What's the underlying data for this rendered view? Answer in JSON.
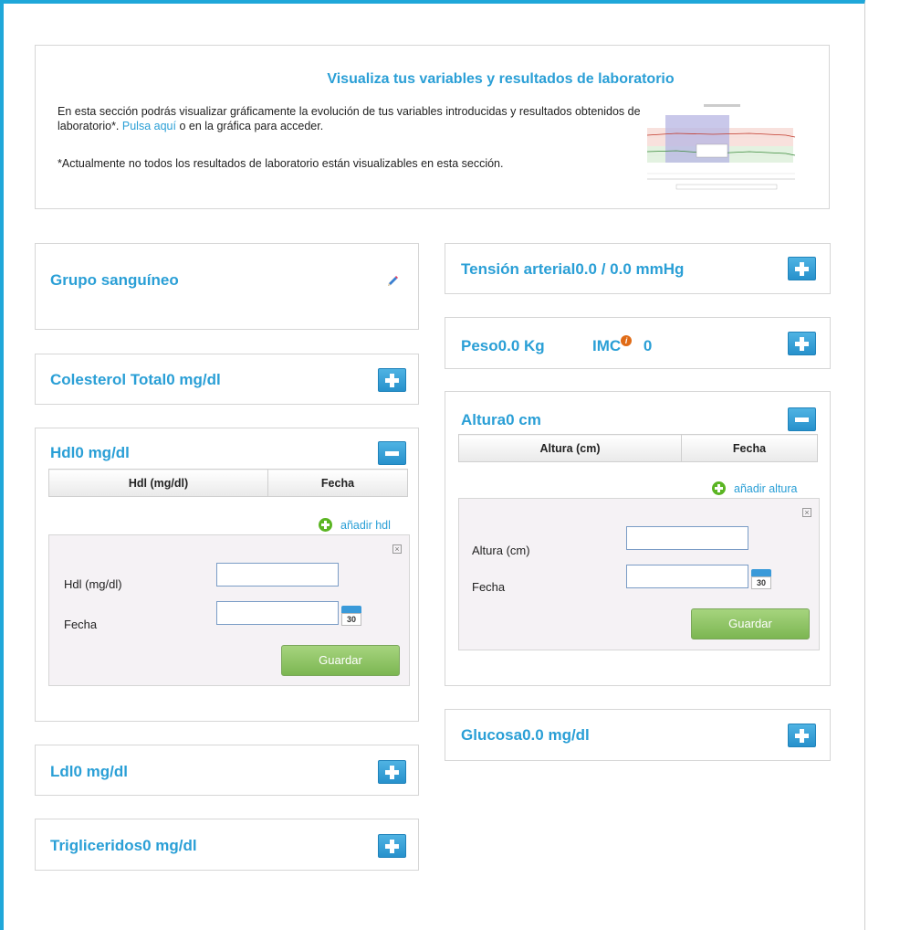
{
  "intro": {
    "title": "Visualiza tus variables y resultados de laboratorio",
    "text_before_link": "En esta sección podrás visualizar gráficamente la evolución de tus variables introducidas y resultados obtenidos de laboratorio*.",
    "link": "Pulsa aquí",
    "text_after_link": "o en la gráfica para acceder.",
    "note": "*Actualmente no todos los resultados de laboratorio están visualizables en esta sección."
  },
  "grupo_sanguineo": {
    "label": "Grupo sanguíneo",
    "icon": "pencil-icon"
  },
  "colesterol": {
    "label": "Colesterol Total",
    "value": "0 mg/dl"
  },
  "hdl": {
    "label": "Hdl",
    "value": "0 mg/dl",
    "columns": [
      "Hdl (mg/dl)",
      "Fecha"
    ],
    "add_label": "añadir hdl",
    "field_label": "Hdl (mg/dl)",
    "date_label": "Fecha",
    "calendar_day": "30",
    "save": "Guardar"
  },
  "ldl": {
    "label": "Ldl",
    "value": "0 mg/dl"
  },
  "trigliceridos": {
    "label": "Trigliceridos",
    "value": "0 mg/dl"
  },
  "tension": {
    "label": "Tensión arterial",
    "value": "0.0 / 0.0 mmHg"
  },
  "peso": {
    "label": "Peso",
    "value": "0.0 Kg",
    "imc_label": "IMC",
    "imc_info": "i",
    "imc_value": "0"
  },
  "altura": {
    "label": "Altura",
    "value": "0 cm",
    "columns": [
      "Altura (cm)",
      "Fecha"
    ],
    "add_label": "añadir altura",
    "field_label": "Altura (cm)",
    "date_label": "Fecha",
    "calendar_day": "30",
    "save": "Guardar"
  },
  "glucosa": {
    "label": "Glucosa",
    "value": "0.0 mg/dl"
  },
  "colors": {
    "accent": "#2a9fd6",
    "frame": "#1fa7d9",
    "save_green": "#7cb652",
    "add_green": "#5bb523"
  }
}
